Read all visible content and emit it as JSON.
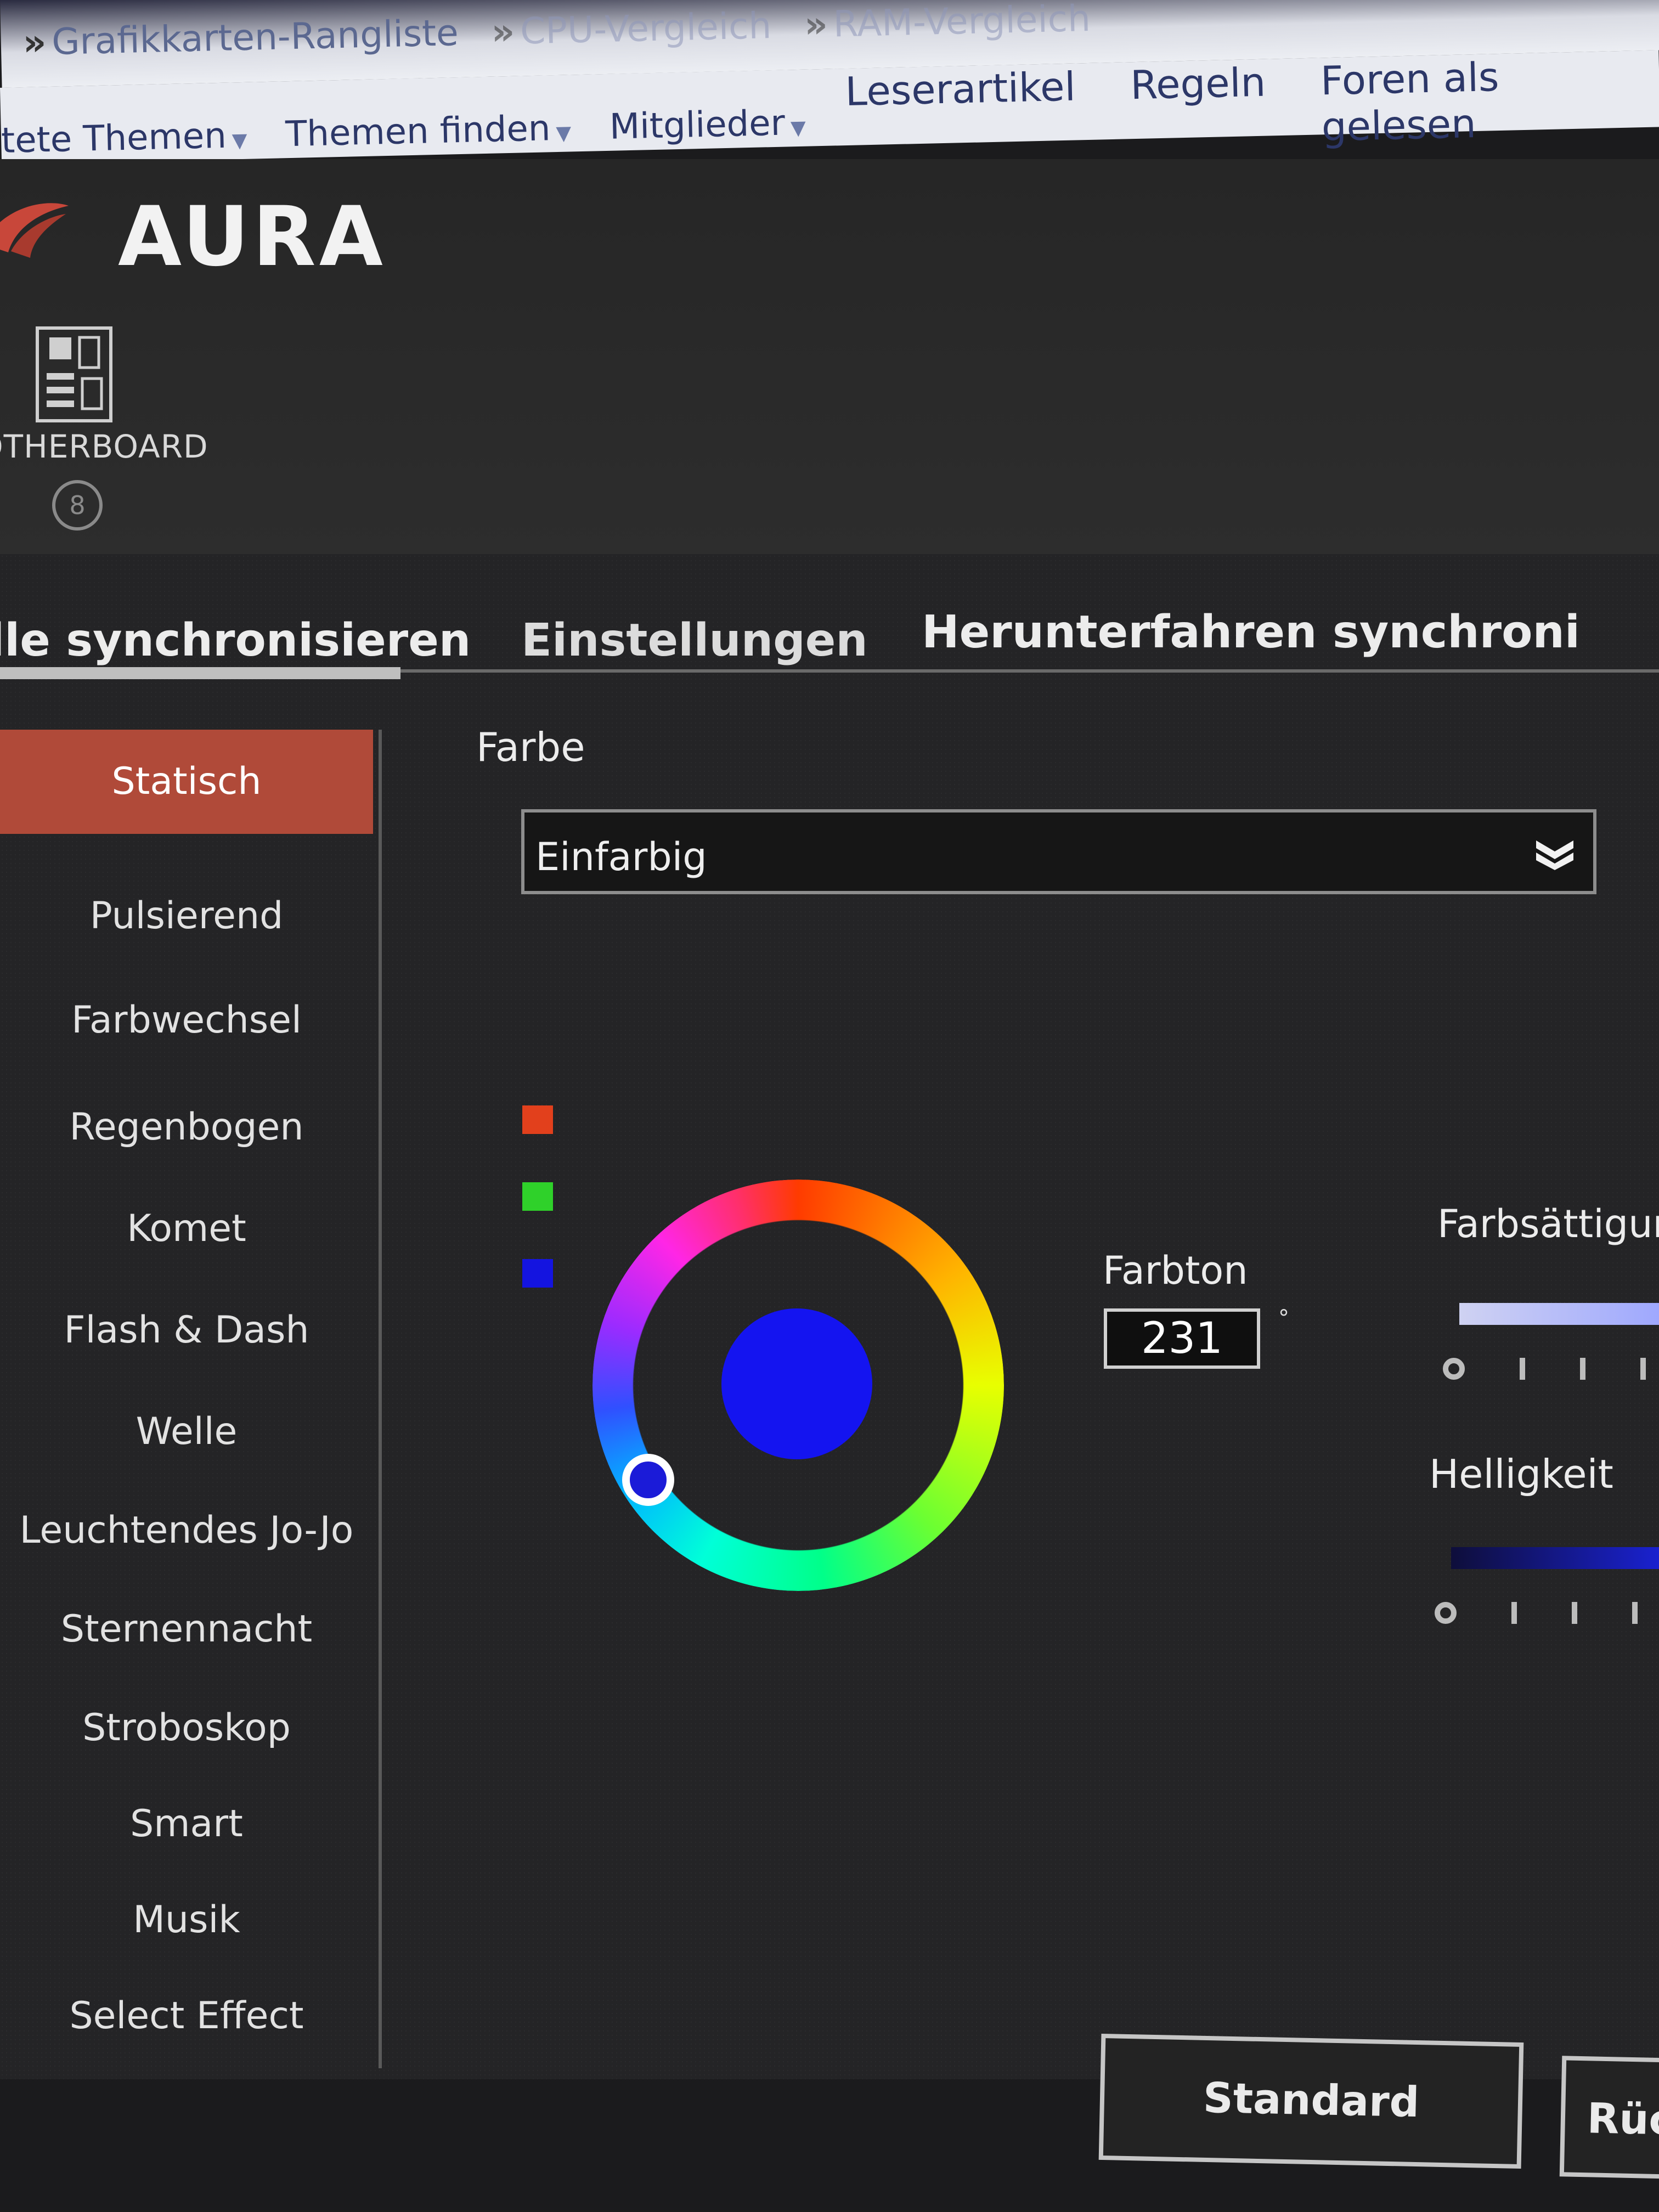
{
  "forum": {
    "crumbs": [
      "Grafikkarten-Rangliste",
      "CPU-Vergleich",
      "RAM-Vergleich"
    ],
    "nav_left": [
      "tete Themen",
      "Themen finden",
      "Mitglieder"
    ],
    "nav_right": [
      "Leserartikel",
      "Regeln",
      "Foren als gelesen"
    ]
  },
  "app": {
    "title": "AURA",
    "device": {
      "label": "OTHERBOARD",
      "badge": "8"
    },
    "tabs": [
      "lle synchronisieren",
      "Einstellungen",
      "Herunterfahren synchroni"
    ],
    "effects": [
      "Statisch",
      "Pulsierend",
      "Farbwechsel",
      "Regenbogen",
      "Komet",
      "Flash & Dash",
      "Welle",
      "Leuchtendes Jo-Jo",
      "Sternennacht",
      "Stroboskop",
      "Smart",
      "Musik",
      "Select Effect"
    ],
    "active_effect": "Statisch",
    "color_section_label": "Farbe",
    "color_mode": "Einfarbig",
    "swatches": [
      "#e2401c",
      "#2fd12a",
      "#1414e0"
    ],
    "selected_color": "#1414f0",
    "hue_label": "Farbton",
    "hue_value": "231",
    "hue_unit": "°",
    "saturation_label": "Farbsättigur",
    "brightness_label": "Helligkeit",
    "buttons": {
      "standard": "Standard",
      "back": "Rüc"
    }
  }
}
